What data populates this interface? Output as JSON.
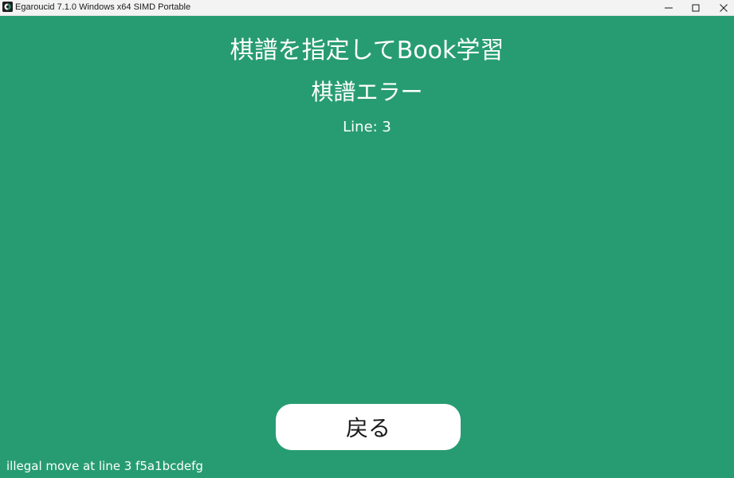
{
  "window": {
    "title": "Egaroucid 7.1.0 Windows x64 SIMD Portable",
    "icons": {
      "app": "egaroucid-app-icon",
      "minimize": "minimize-icon",
      "maximize": "maximize-icon",
      "close": "close-icon"
    }
  },
  "screen": {
    "title": "棋譜を指定してBook学習",
    "subtitle": "棋譜エラー",
    "line_info": "Line: 3",
    "back_button": "戻る",
    "status_message": "illegal move at line 3 f5a1bcdefg"
  },
  "colors": {
    "background": "#279c73",
    "titlebar": "#f3f3f3",
    "button_bg": "#ffffff",
    "text": "#ffffff"
  }
}
